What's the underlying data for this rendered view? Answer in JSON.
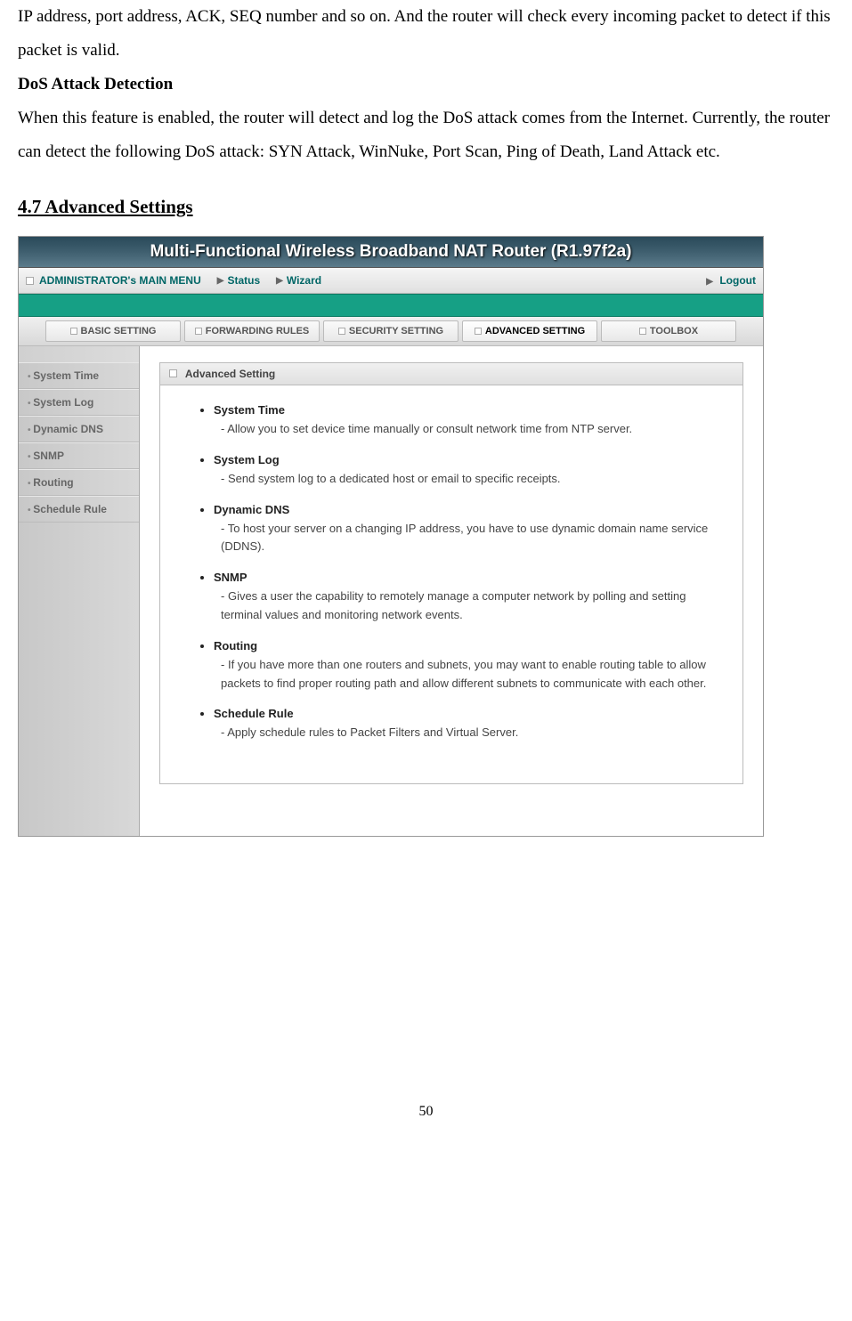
{
  "doc": {
    "para1": "IP address, port address, ACK, SEQ number and so on. And the router will check every incoming packet to detect if this packet is valid.",
    "heading_dos": "DoS Attack Detection",
    "para2": "When this feature is enabled, the router will detect and log the DoS attack comes from the Internet. Currently, the router can detect the following DoS attack: SYN Attack, WinNuke, Port Scan, Ping of Death, Land Attack etc.",
    "section": "4.7 Advanced Settings",
    "page_num": "50"
  },
  "router": {
    "title": "Multi-Functional Wireless Broadband NAT Router (R1.97f2a)",
    "menu": {
      "main": "ADMINISTRATOR's MAIN MENU",
      "status": "Status",
      "wizard": "Wizard",
      "logout": "Logout"
    },
    "tabs": {
      "basic": "BASIC SETTING",
      "forwarding": "FORWARDING RULES",
      "security": "SECURITY SETTING",
      "advanced": "ADVANCED SETTING",
      "toolbox": "TOOLBOX"
    },
    "sidebar": {
      "i0": "System Time",
      "i1": "System Log",
      "i2": "Dynamic DNS",
      "i3": "SNMP",
      "i4": "Routing",
      "i5": "Schedule Rule"
    },
    "panel": {
      "title": "Advanced Setting",
      "items": {
        "t0": "System Time",
        "d0": "Allow you to set device time manually or consult network time from NTP server.",
        "t1": "System Log",
        "d1": "Send system log to a dedicated host or email to specific receipts.",
        "t2": "Dynamic DNS",
        "d2": "To host your server on a changing IP address, you have to use dynamic domain name service (DDNS).",
        "t3": "SNMP",
        "d3": "Gives a user the capability to remotely manage a computer network by polling and setting terminal values and monitoring network events.",
        "t4": "Routing",
        "d4": "If you have more than one routers and subnets, you may want to enable routing table to allow packets to find proper routing path and allow different subnets to communicate with each other.",
        "t5": "Schedule Rule",
        "d5": "Apply schedule rules to Packet Filters and Virtual Server."
      }
    }
  }
}
